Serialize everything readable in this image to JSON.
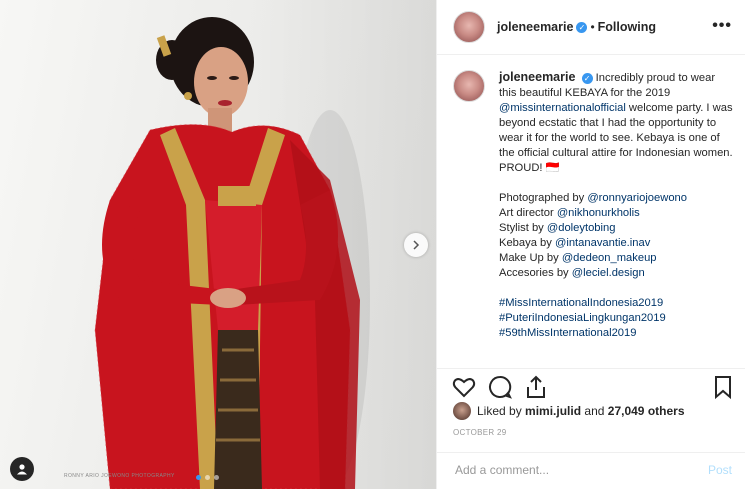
{
  "media": {
    "credit": "RONNY ARIO JOEWONO PHOTOGRAPHY",
    "carousel_count": 3,
    "carousel_active": 1
  },
  "header": {
    "username": "joleneemarie",
    "separator": "•",
    "follow_status": "Following",
    "more": "•••"
  },
  "caption": {
    "username": "joleneemarie",
    "text_intro": "Incredibly proud to wear this beautiful KEBAYA for the 2019",
    "mention_1": "@missinternationalofficial",
    "text_rest": "welcome party. I was beyond ecstatic that I had the opportunity to wear it for the world to see. Kebaya is one of the official cultural attire for Indonesian women. PROUD! 🇮🇩",
    "credits": [
      {
        "label": "Photographed by",
        "handle": "@ronnyariojoewono"
      },
      {
        "label": "Art director",
        "handle": "@nikhonurkholis"
      },
      {
        "label": "Stylist by",
        "handle": "@doleytobing"
      },
      {
        "label": "Kebaya by",
        "handle": "@intanavantie.inav"
      },
      {
        "label": "Make Up by",
        "handle": "@dedeon_makeup"
      },
      {
        "label": "Accesories by",
        "handle": "@leciel.design"
      }
    ],
    "hashtags": [
      "#MissInternationalIndonesia2019",
      "#PuteriIndonesiaLingkungan2019",
      "#59thMissInternational2019"
    ]
  },
  "likes": {
    "prefix": "Liked by",
    "user": "mimi.julid",
    "middle": "and",
    "count": "27,049 others"
  },
  "date": "OCTOBER 29",
  "comment": {
    "placeholder": "Add a comment...",
    "post_label": "Post"
  },
  "colors": {
    "accent": "#3897f0",
    "link": "#003569",
    "kebaya_red": "#c8141e",
    "gold_trim": "#c9a24a"
  }
}
